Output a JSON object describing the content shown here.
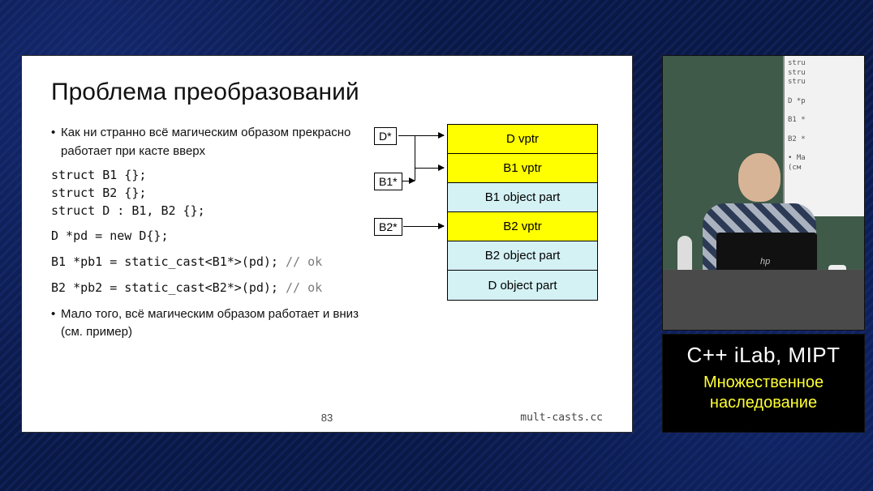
{
  "slide": {
    "title": "Проблема преобразований",
    "bullet1": "Как ни странно всё магическим образом прекрасно работает при касте вверх",
    "code1": "struct B1 {};\nstruct B2 {};\nstruct D : B1, B2 {};",
    "code2": "D *pd = new D{};",
    "code3_a": "B1 *pb1 = static_cast<B1*>(pd); ",
    "code3_comment": "// ok",
    "code4_a": "B2 *pb2 = static_cast<B2*>(pd); ",
    "code4_comment": "// ok",
    "bullet2": "Мало того, всё магическим образом работает и вниз (см. пример)",
    "page": "83",
    "file": "mult-casts.cc"
  },
  "diagram": {
    "ptr_d": "D*",
    "ptr_b1": "B1*",
    "ptr_b2": "B2*",
    "rows": {
      "r0": "D vptr",
      "r1": "B1 vptr",
      "r2": "B1 object part",
      "r3": "B2 vptr",
      "r4": "B2 object part",
      "r5": "D object part"
    }
  },
  "cam_screen": "stru\nstru\nstru\n\nD *p\n\nB1 *\n\nB2 *\n\n• Ма\n(см",
  "info": {
    "line1": "C++ iLab, MIPT",
    "line2a": "Множественное",
    "line2b": "наследование"
  }
}
